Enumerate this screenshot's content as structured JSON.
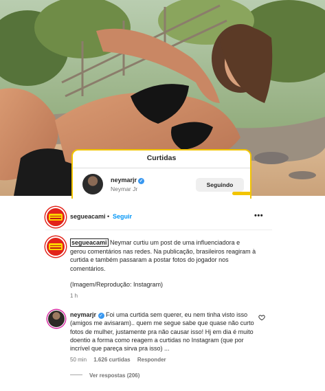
{
  "likes_panel": {
    "title": "Curtidas",
    "username": "neymarjr",
    "full_name": "Neymar Jr",
    "button_label": "Seguindo"
  },
  "post": {
    "username": "segueacami",
    "separator": "•",
    "follow_label": "Seguir",
    "more_label": "•••"
  },
  "caption": {
    "username": "segueacami",
    "text": " Neymar curtiu um post de uma influenciadora e gerou comentários nas redes. Na publicação, brasileiros reagiram à curtida e também passaram a postar fotos do jogador nos comentários.",
    "credit": "(Imagem/Reprodução: Instagram)",
    "time": "1 h"
  },
  "comment": {
    "username": "neymarjr",
    "verified_glyph": "✓",
    "text": " Foi uma curtida sem querer, eu nem tinha visto isso (amigos me avisaram).. quem me segue sabe que quase não curto fotos de mulher, justamente pra não causar isso! Hj em dia é muito doentio a forma como reagem a curtidas no Instagram (que por incrível que pareça sirva pra isso) ...",
    "time": "50 min",
    "likes": "1.626 curtidas",
    "reply_label": "Responder",
    "view_replies": "Ver respostas (206)"
  },
  "icons": {
    "verified": "verified-badge-icon",
    "heart": "heart-icon",
    "more": "more-options-icon"
  },
  "colors": {
    "link_blue": "#0095f6",
    "verified_blue": "#3897f0",
    "card_highlight": "#f2c400",
    "brand_red": "#e2231a",
    "brand_yellow": "#ffd400"
  }
}
